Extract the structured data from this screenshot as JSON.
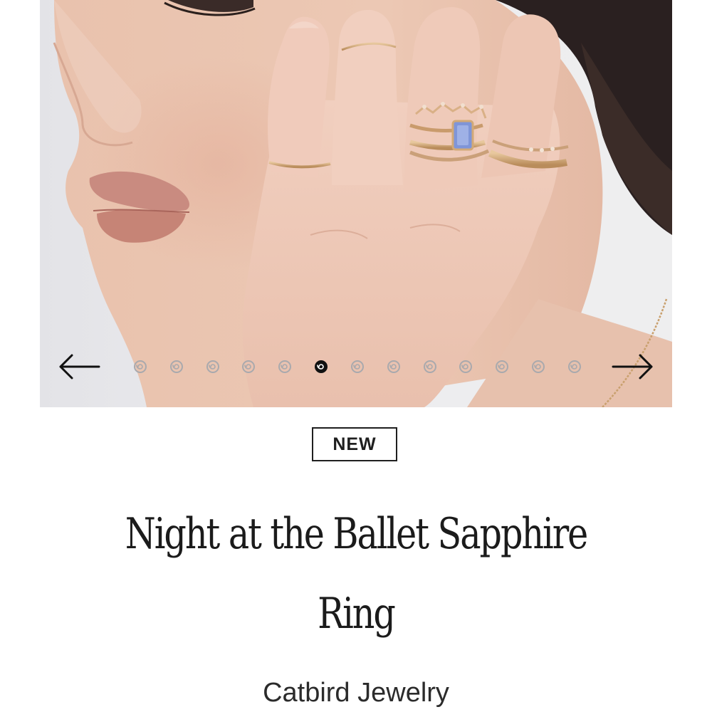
{
  "carousel": {
    "image_alt": "Model wearing stacked gold rings with a blue sapphire ring",
    "slide_count": 13,
    "active_index": 5,
    "prev_icon": "arrow-left-icon",
    "next_icon": "arrow-right-icon",
    "dot_icon": "swirl-icon"
  },
  "product": {
    "badge": "NEW",
    "title": "Night at the Ballet Sapphire Ring",
    "brand": "Catbird Jewelry"
  },
  "colors": {
    "text": "#1d1d1d",
    "dot_active": "#111111",
    "dot_inactive": "#a9a9ad",
    "sapphire": "#7f95d8",
    "gold": "#d2a977"
  }
}
